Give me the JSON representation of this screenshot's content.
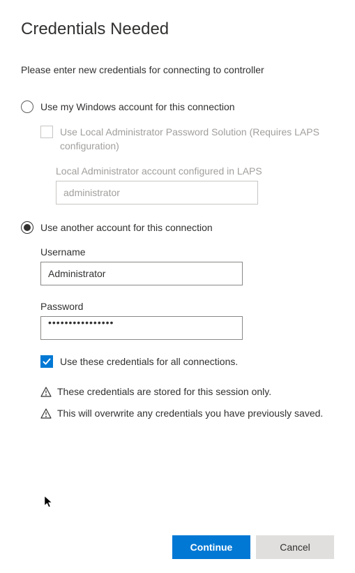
{
  "title": "Credentials Needed",
  "subtitle": "Please enter new credentials for connecting to controller",
  "option1": {
    "label": "Use my Windows account for this connection",
    "selected": false,
    "laps_checkbox": {
      "label": "Use Local Administrator Password Solution (Requires LAPS configuration)",
      "checked": false,
      "disabled": true
    },
    "laps_field": {
      "label": "Local Administrator account configured in LAPS",
      "placeholder": "administrator",
      "value": "",
      "disabled": true
    }
  },
  "option2": {
    "label": "Use another account for this connection",
    "selected": true,
    "username": {
      "label": "Username",
      "value": "Administrator"
    },
    "password": {
      "label": "Password",
      "value": "••••••••••••••••"
    },
    "use_for_all": {
      "label": "Use these credentials for all connections.",
      "checked": true
    },
    "warning1": "These credentials are stored for this session only.",
    "warning2": "This will overwrite any credentials you have previously saved."
  },
  "buttons": {
    "continue": "Continue",
    "cancel": "Cancel"
  }
}
